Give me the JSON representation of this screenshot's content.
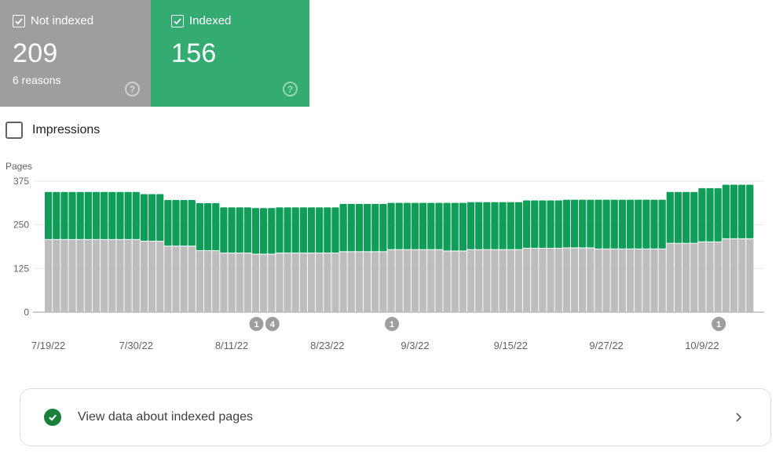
{
  "tiles": {
    "not_indexed": {
      "label": "Not indexed",
      "value": "209",
      "sub": "6 reasons",
      "checked": true,
      "color": "#9e9e9e",
      "help_icon": "help-circle-icon"
    },
    "indexed": {
      "label": "Indexed",
      "value": "156",
      "checked": true,
      "color": "#33ab71",
      "help_icon": "help-circle-icon"
    }
  },
  "impressions": {
    "label": "Impressions",
    "checked": false
  },
  "chart_data": {
    "type": "bar",
    "stacked": true,
    "ylabel": "Pages",
    "ylim": [
      0,
      375
    ],
    "yticks": [
      0,
      125,
      250,
      375
    ],
    "grid": true,
    "x_tick_labels": [
      "7/19/22",
      "7/30/22",
      "8/11/22",
      "8/23/22",
      "9/3/22",
      "9/15/22",
      "9/27/22",
      "10/9/22"
    ],
    "x_start_date": "7/19/22",
    "x_end_date": "10/15/22",
    "series": [
      {
        "name": "Not indexed",
        "color": "#bdbdbd",
        "values": [
          207,
          207,
          207,
          207,
          207,
          207,
          207,
          207,
          207,
          207,
          207,
          207,
          202,
          202,
          202,
          188,
          188,
          188,
          188,
          175,
          175,
          175,
          168,
          168,
          168,
          168,
          165,
          165,
          165,
          168,
          168,
          168,
          168,
          168,
          168,
          168,
          168,
          172,
          172,
          172,
          172,
          172,
          172,
          178,
          178,
          178,
          178,
          178,
          178,
          178,
          174,
          174,
          174,
          178,
          178,
          178,
          178,
          178,
          178,
          178,
          182,
          182,
          182,
          182,
          182,
          183,
          183,
          183,
          183,
          180,
          180,
          180,
          180,
          180,
          180,
          180,
          180,
          180,
          196,
          196,
          196,
          196,
          200,
          200,
          200,
          209,
          209,
          209,
          209
        ]
      },
      {
        "name": "Indexed",
        "color": "#0f9d58",
        "values": [
          137,
          137,
          137,
          137,
          137,
          137,
          137,
          137,
          137,
          137,
          137,
          137,
          136,
          136,
          136,
          133,
          133,
          133,
          133,
          137,
          137,
          137,
          132,
          132,
          132,
          132,
          133,
          133,
          133,
          132,
          132,
          132,
          132,
          132,
          132,
          132,
          132,
          138,
          138,
          138,
          138,
          138,
          138,
          135,
          135,
          135,
          135,
          135,
          135,
          135,
          139,
          139,
          139,
          137,
          137,
          137,
          137,
          137,
          137,
          137,
          138,
          138,
          138,
          138,
          138,
          139,
          139,
          139,
          139,
          142,
          142,
          142,
          142,
          142,
          142,
          142,
          142,
          142,
          148,
          148,
          148,
          148,
          155,
          155,
          155,
          156,
          156,
          156,
          156
        ]
      }
    ],
    "annotations": [
      {
        "label": "1",
        "date_index": 26
      },
      {
        "label": "4",
        "date_index": 28
      },
      {
        "label": "1",
        "date_index": 43
      },
      {
        "label": "1",
        "date_index": 84
      }
    ]
  },
  "card": {
    "label": "View data about indexed pages",
    "icon": "check-circle-icon",
    "chevron": "chevron-right-icon"
  }
}
